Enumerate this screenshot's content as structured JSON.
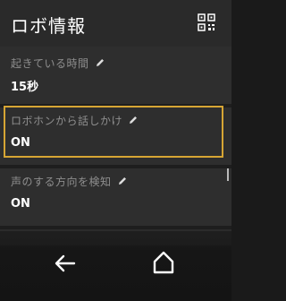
{
  "header": {
    "title": "ロボ情報",
    "qr_icon": "qr-code-icon"
  },
  "settings": [
    {
      "label": "起きている時間",
      "value": "15秒",
      "edit_icon": "pencil-icon"
    },
    {
      "label": "ロボホンから話しかけ",
      "value": "ON",
      "edit_icon": "pencil-icon",
      "highlighted": true
    },
    {
      "label": "声のする方向を検知",
      "value": "ON",
      "edit_icon": "pencil-icon"
    }
  ],
  "navbar": {
    "back_icon": "back-arrow-icon",
    "home_icon": "home-icon"
  },
  "colors": {
    "highlight_border": "#d6a534",
    "background": "#2b2b2b",
    "label": "#8e8e8e"
  }
}
